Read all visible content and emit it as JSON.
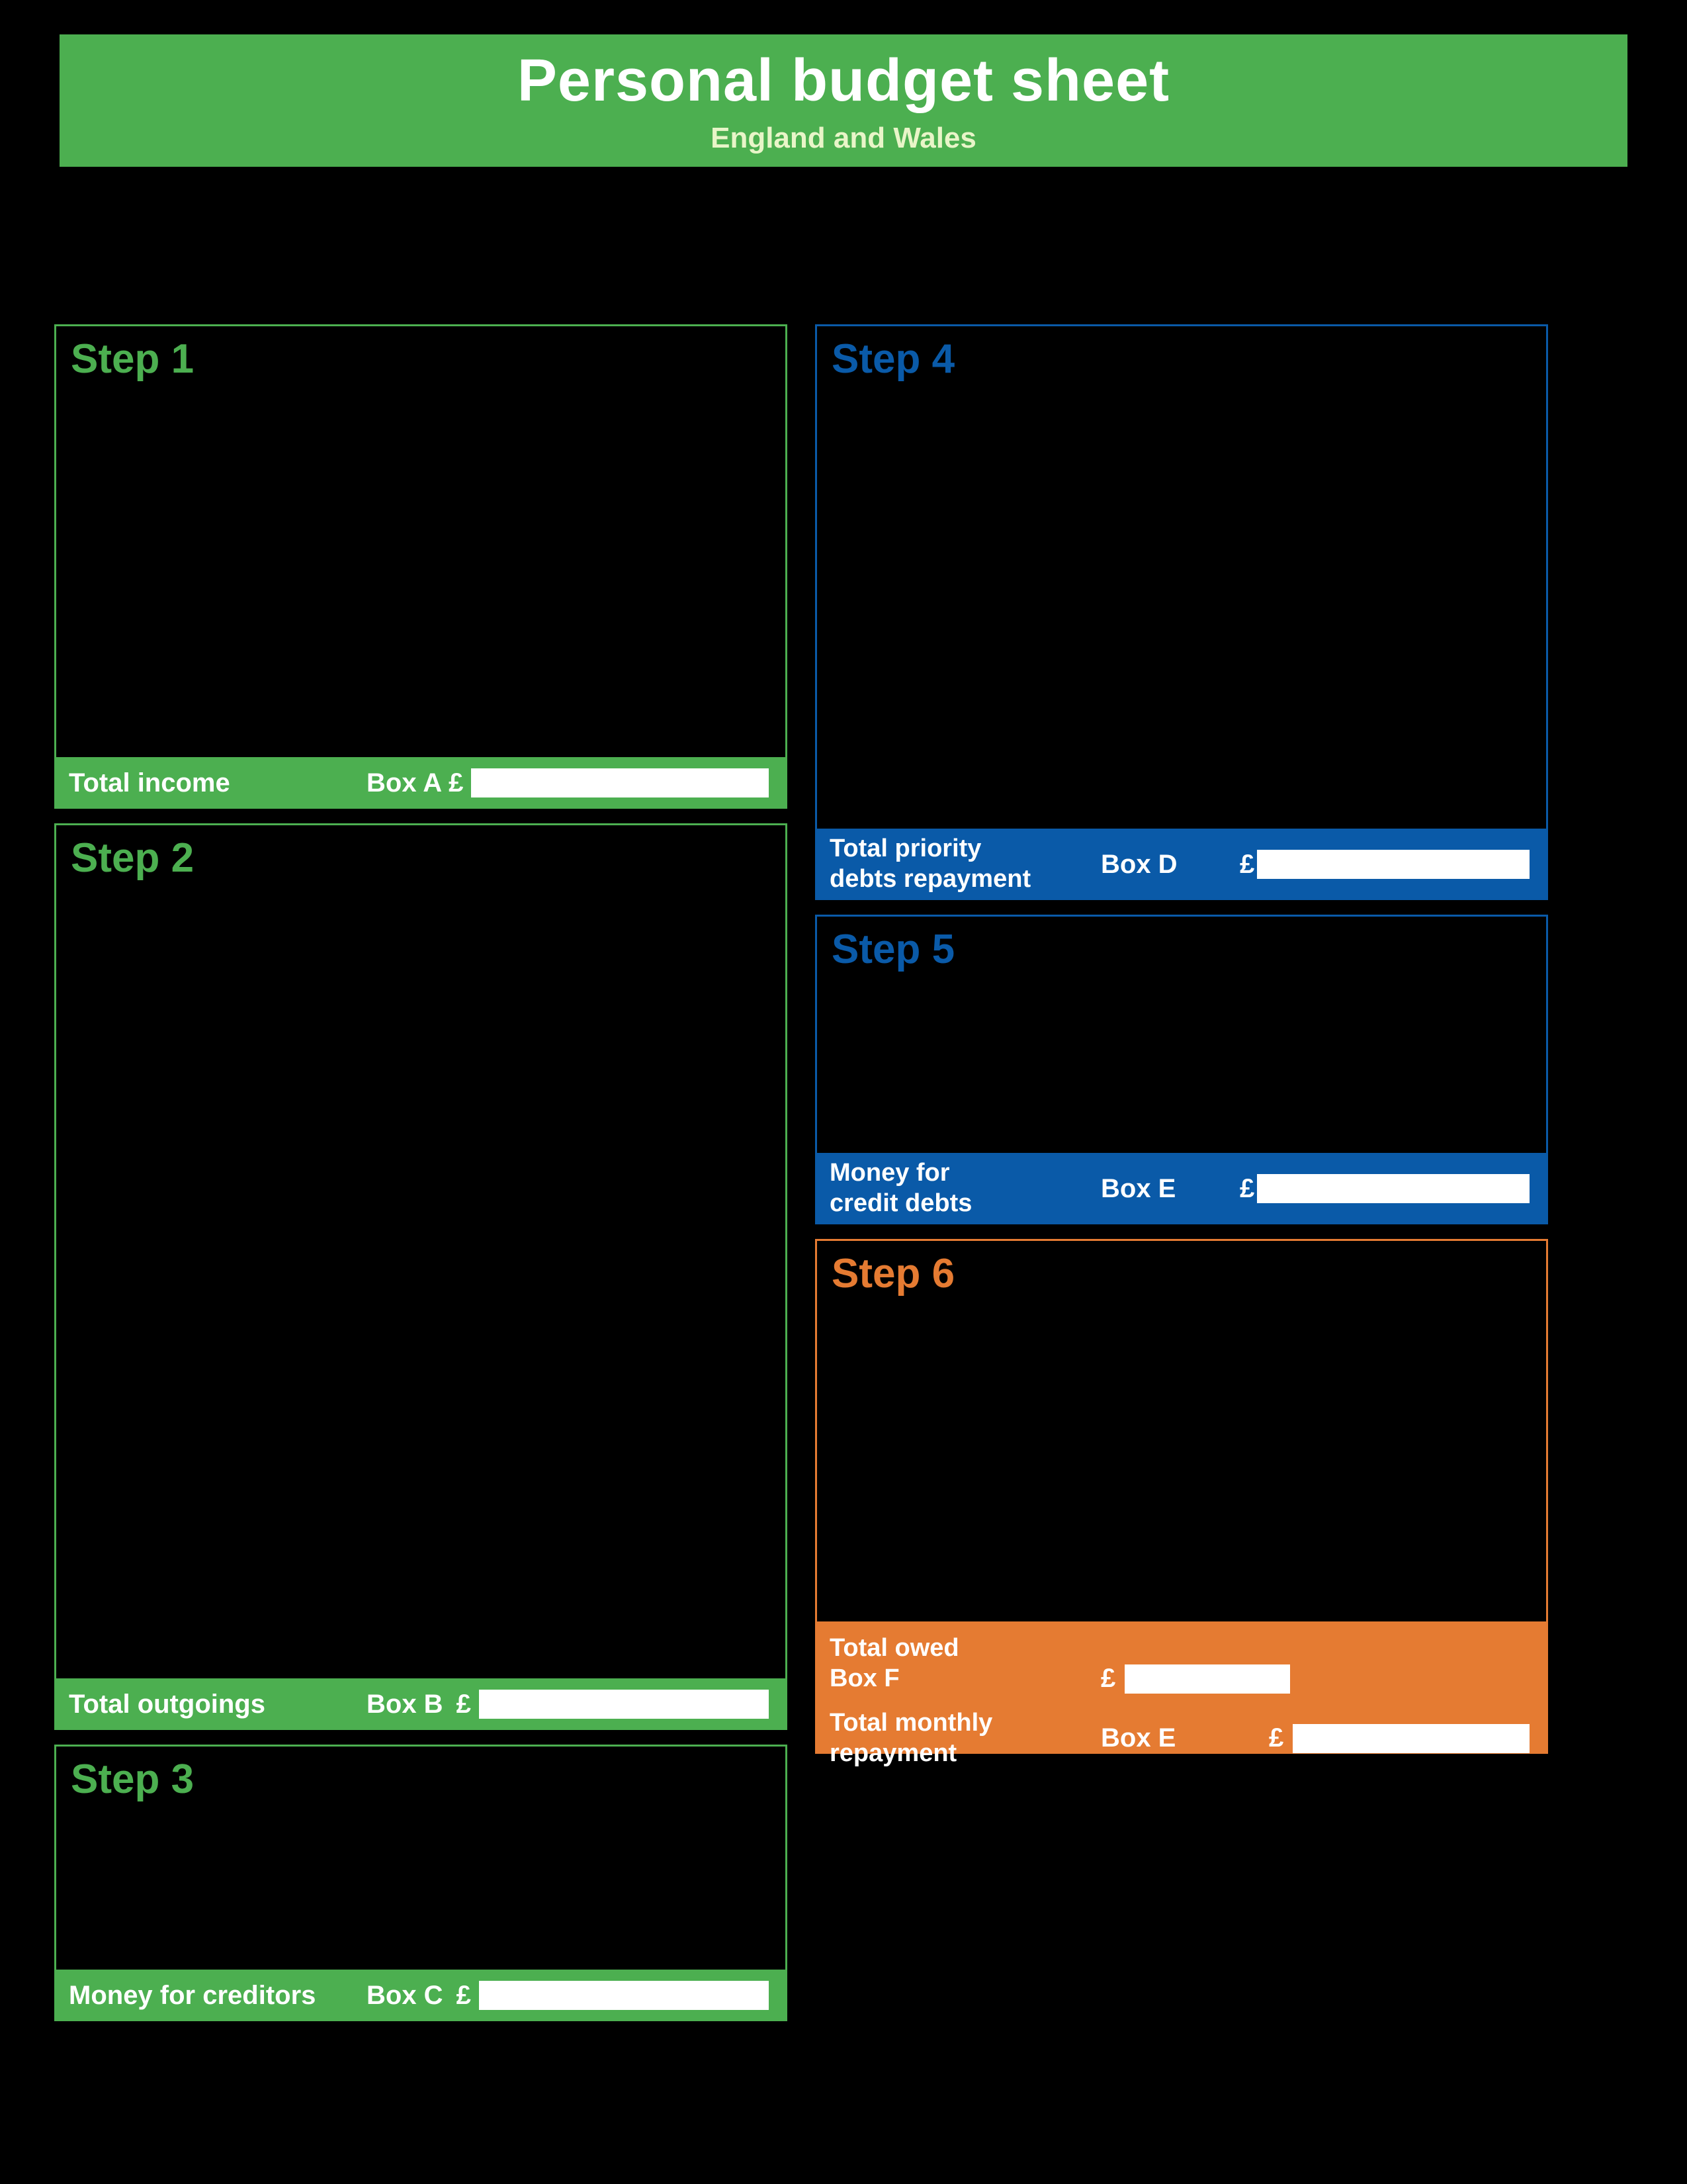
{
  "header": {
    "title": "Personal budget sheet",
    "subtitle": "England and Wales"
  },
  "steps": {
    "s1": {
      "title": "Step 1",
      "footer_label": "Total income",
      "box": "Box A",
      "currency": "£"
    },
    "s2": {
      "title": "Step 2",
      "footer_label": "Total outgoings",
      "box": "Box B",
      "currency": "£"
    },
    "s3": {
      "title": "Step 3",
      "footer_label": "Money for creditors",
      "box": "Box C",
      "currency": "£"
    },
    "s4": {
      "title": "Step 4",
      "footer_label_line1": "Total priority",
      "footer_label_line2": "debts repayment",
      "box": "Box D",
      "currency": "£"
    },
    "s5": {
      "title": "Step 5",
      "footer_label_line1": "Money for",
      "footer_label_line2": "credit debts",
      "box": "Box E",
      "currency": "£"
    },
    "s6": {
      "title": "Step 6",
      "owed_label": "Total owed",
      "owed_box": "Box F",
      "repay_label_line1": "Total monthly",
      "repay_label_line2": "repayment",
      "repay_box": "Box E",
      "currency": "£"
    }
  }
}
